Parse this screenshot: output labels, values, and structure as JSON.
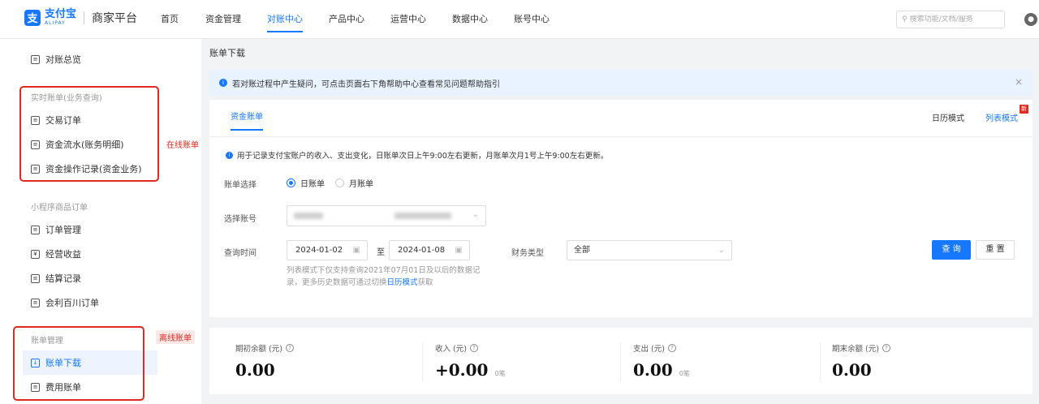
{
  "header": {
    "logo_mark": "支",
    "logo_cn": "支付宝",
    "logo_en": "ALIPAY",
    "platform": "商家平台",
    "nav": [
      "首页",
      "资金管理",
      "对账中心",
      "产品中心",
      "运营中心",
      "数据中心",
      "账号中心"
    ],
    "active_nav": "对账中心",
    "search_placeholder": "搜索功能/文档/服务"
  },
  "sidebar": {
    "overview": "对账总览",
    "group_realtime": "实时账单(业务查询)",
    "realtime_items": [
      "交易订单",
      "资金流水(账务明细)",
      "资金操作记录(资金业务)"
    ],
    "group_miniapp": "小程序商品订单",
    "miniapp_items": [
      "订单管理",
      "经营收益",
      "结算记录",
      "会利百川订单"
    ],
    "group_bill": "账单管理",
    "bill_items": [
      "账单下载",
      "费用账单"
    ],
    "annotation_online": "在线账单",
    "annotation_offline": "离线账单"
  },
  "main": {
    "page_title": "账单下载",
    "notice": "若对账过程中产生疑问，可点击页面右下角帮助中心查看常见问题帮助指引",
    "tab": "资金账单",
    "mode_calendar": "日历模式",
    "mode_list": "列表模式",
    "new_badge": "新",
    "description": "用于记录支付宝账户的收入、支出变化，日账单次日上午9:00左右更新，月账单次月1号上午9:00左右更新。",
    "form": {
      "bill_select_label": "账单选择",
      "radio_day": "日账单",
      "radio_month": "月账单",
      "account_label": "选择账号",
      "time_label": "查询时间",
      "date_from": "2024-01-02",
      "date_sep": "至",
      "date_to": "2024-01-08",
      "finance_type_label": "财务类型",
      "finance_type_value": "全部",
      "query_button": "查 询",
      "reset_button": "重 置",
      "hint_pre": "列表模式下仅支持查询2021年07月01日及以后的数据记录，更多历史数据可通过切换",
      "hint_link": "日历模式",
      "hint_post": "获取"
    },
    "stats": [
      {
        "label": "期初余额 (元)",
        "value": "0.00",
        "count": ""
      },
      {
        "label": "收入 (元)",
        "value": "+0.00",
        "count": "0笔"
      },
      {
        "label": "支出 (元)",
        "value": "0.00",
        "count": "0笔"
      },
      {
        "label": "期末余额 (元)",
        "value": "0.00",
        "count": ""
      }
    ]
  }
}
